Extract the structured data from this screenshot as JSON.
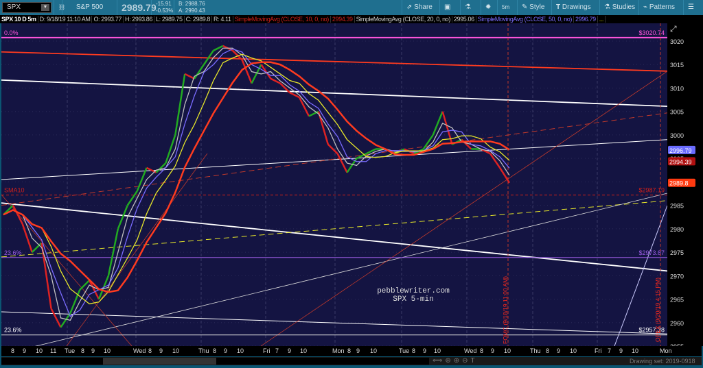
{
  "toolbar": {
    "symbol": "SPX",
    "description": "S&P 500 INDEX",
    "last": "2989.79",
    "change": "-15.91",
    "change_pct": "-0.53%",
    "bid": "B: 2988.76",
    "ask": "A: 2990.43",
    "buttons": [
      "Share",
      "5m",
      "Style",
      "Drawings",
      "Studies",
      "Patterns"
    ]
  },
  "infobar": {
    "chart": "SPX 10 D 5m",
    "date": "D: 9/18/19 11:10 AM",
    "open": "O: 2993.77",
    "high": "H: 2993.86",
    "low": "L: 2989.75",
    "close": "C: 2989.8",
    "range": "R: 4.11",
    "sma10": "SimpleMovingAvg (CLOSE, 10, 0, no)",
    "sma10_val": "2994.39",
    "sma20": "SimpleMovingAvg (CLOSE, 20, 0, no)",
    "sma20_val": "2995.06",
    "sma50": "SimpleMovingAvg (CLOSE, 50, 0, no)",
    "sma50_val": "2996.79",
    "more": "..."
  },
  "annotations": {
    "fib0": "0.0%",
    "fib0_price": "$3020.74",
    "fib236": "23.6%",
    "fib236_price": "$2973.87",
    "fib236b": "23.6%",
    "fib236b_price": "$2957.38",
    "sma_label": "SMA10",
    "sma_price": "$2987.19",
    "watermark1": "pebblewriter.com",
    "watermark2": "SPX 5-min",
    "fomc": "FOMC (9/18/19 11:00 AM)",
    "opex": "OPEX (9/20/19 4:15 PM)"
  },
  "status": {
    "drawing_set": "Drawing set: 2019-0918"
  },
  "colors": {
    "bg": "#141442",
    "sma10": "#ff3b1f",
    "sma20": "#c0c0c0",
    "sma50": "#7a6cff",
    "sma200": "#ff3b1f",
    "yellow": "#e6e62a",
    "fib": "#ff55dd",
    "fib236": "#9b5de5",
    "up": "#22aa22",
    "down": "#dd2222"
  },
  "chart_data": {
    "type": "line",
    "title": "SPX 10 D 5m",
    "ylim": [
      2954,
      3023
    ],
    "yticks": [
      3020,
      3015,
      3010,
      3005,
      3000,
      2995,
      2990,
      2985,
      2980,
      2975,
      2970,
      2965,
      2960,
      2955
    ],
    "xticks": [
      "8",
      "9",
      "10",
      "11",
      "Tue",
      "8",
      "9",
      "10",
      "Wed",
      "8",
      "9",
      "10",
      "Thu",
      "8",
      "9",
      "10",
      "Fri",
      "7",
      "9",
      "10",
      "Mon",
      "8",
      "9",
      "10",
      "Tue",
      "8",
      "9",
      "10",
      "Wed",
      "8",
      "9",
      "10",
      "Thu",
      "8",
      "9",
      "10",
      "Fri",
      "7",
      "9",
      "10",
      "Mon"
    ],
    "price": [
      2983,
      2985,
      2981,
      2975,
      2977,
      2963,
      2959,
      2962,
      2967,
      2969,
      2965,
      2970,
      2980,
      2985,
      2988,
      2993,
      2992,
      2994,
      3000,
      3013,
      3012,
      3015,
      3018,
      3019,
      3018,
      3016,
      3011,
      3015,
      3012,
      3011,
      3009,
      3008,
      3004,
      3005,
      2998,
      2996,
      2992,
      2995,
      2996,
      2997,
      2997,
      2996,
      2997,
      2996,
      2997,
      3000,
      3005,
      2998,
      2999,
      2997,
      2997,
      2996,
      2993,
      2989.8
    ],
    "price_labels": {
      "sma50": 2996.79,
      "sma10": 2994.39,
      "last": 2989.8
    },
    "horizontal_levels": [
      3020.74,
      2987.19,
      2973.87,
      2957.38
    ],
    "trendlines": [
      {
        "color": "#ff3b1f",
        "from": 3017.7,
        "to": 3013.6,
        "style": "thick"
      },
      {
        "color": "#ffffff",
        "from": 3011.7,
        "to": 3006.1,
        "style": "thick"
      },
      {
        "color": "#ffffff",
        "from": 2990.5,
        "to": 2999,
        "style": "thin"
      },
      {
        "color": "#ffffff",
        "from": 2985.5,
        "to": 2971,
        "style": "thick"
      },
      {
        "color": "#ffffff",
        "from": 2962.3,
        "to": 2957.6,
        "style": "thin"
      },
      {
        "color": "#e6e62a",
        "from": 2974,
        "to": 2986,
        "style": "dashed"
      },
      {
        "color": "#c0392b",
        "from": 2985,
        "to": 3004.7,
        "style": "dashed"
      }
    ]
  }
}
